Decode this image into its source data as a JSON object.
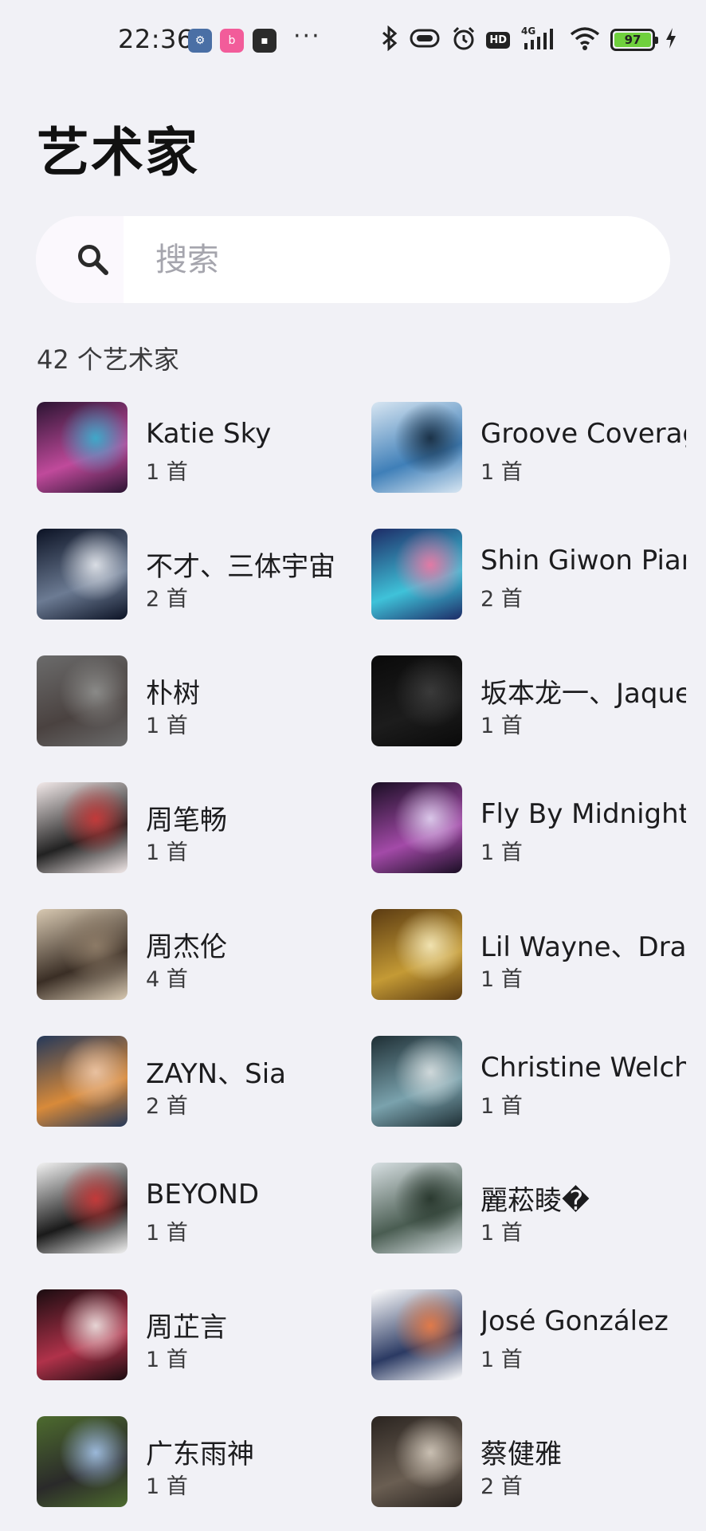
{
  "status_bar": {
    "time": "22:36",
    "dots": "···",
    "hd": "HD",
    "network": "4G",
    "battery": "97",
    "icons": [
      "bluetooth-icon",
      "vibrate-icon",
      "alarm-icon",
      "hd-icon",
      "signal-icon",
      "wifi-icon",
      "battery-icon",
      "charging-icon"
    ]
  },
  "page": {
    "title": "艺术家",
    "search_placeholder": "搜索",
    "count_label": "42 个艺术家"
  },
  "colors": {
    "background": "#f1f1f6",
    "search_bg": "#ffffff",
    "battery_fill": "#6fd03d"
  },
  "artists": [
    {
      "name": "Katie Sky",
      "songs": "1 首",
      "cover": [
        "#2b1432",
        "#c04a9b",
        "#3fa8c9"
      ]
    },
    {
      "name": "Groove Coverage",
      "songs": "1 首",
      "cover": [
        "#d8e6f2",
        "#3f7fb8",
        "#1b3248"
      ]
    },
    {
      "name": "不才、三体宇宙",
      "songs": "2 首",
      "cover": [
        "#0b1224",
        "#6c7b93",
        "#d9dde4"
      ]
    },
    {
      "name": "Shin Giwon Piano",
      "songs": "2 首",
      "cover": [
        "#1d2b66",
        "#3fc2d9",
        "#e27aa5"
      ]
    },
    {
      "name": "朴树",
      "songs": "1 首",
      "cover": [
        "#6b6b6b",
        "#4a4240",
        "#8a8a88"
      ]
    },
    {
      "name": "坂本龙一、Jaques Morelenbaum",
      "songs": "1 首",
      "cover": [
        "#0a0a0a",
        "#1c1c1c",
        "#3a3a3a"
      ]
    },
    {
      "name": "周笔畅",
      "songs": "1 首",
      "cover": [
        "#f3eaea",
        "#222222",
        "#c23a3a"
      ]
    },
    {
      "name": "Fly By Midnight",
      "songs": "1 首",
      "cover": [
        "#1a0e24",
        "#a34aa8",
        "#d9c6e8"
      ]
    },
    {
      "name": "周杰伦",
      "songs": "4 首",
      "cover": [
        "#d8c9b2",
        "#3a2e25",
        "#8c7a66"
      ]
    },
    {
      "name": "Lil Wayne、Drake",
      "songs": "1 首",
      "cover": [
        "#5b3b12",
        "#c49a35",
        "#f0e2b0"
      ]
    },
    {
      "name": "ZAYN、Sia",
      "songs": "2 首",
      "cover": [
        "#24385a",
        "#d88a3a",
        "#e9c1a0"
      ]
    },
    {
      "name": "Christine Welch",
      "songs": "1 首",
      "cover": [
        "#1e2e34",
        "#7aa2ad",
        "#cfd8da"
      ]
    },
    {
      "name": "BEYOND",
      "songs": "1 首",
      "cover": [
        "#f3f3f3",
        "#1a1a1a",
        "#c33a3a"
      ]
    },
    {
      "name": "麗菘睖�",
      "songs": "1 首",
      "cover": [
        "#d7dfe2",
        "#4a5d52",
        "#2b3a30"
      ]
    },
    {
      "name": "周芷言",
      "songs": "1 首",
      "cover": [
        "#1a0c10",
        "#b0324a",
        "#e6d4d4"
      ]
    },
    {
      "name": "José González",
      "songs": "1 首",
      "cover": [
        "#ffffff",
        "#2b3a63",
        "#e07a4a"
      ]
    },
    {
      "name": "广东雨神",
      "songs": "1 首",
      "cover": [
        "#4d6b2e",
        "#2a2a2a",
        "#9bb8d9"
      ]
    },
    {
      "name": "蔡健雅",
      "songs": "2 首",
      "cover": [
        "#2a2420",
        "#6a5e52",
        "#c9bfb2"
      ]
    }
  ]
}
